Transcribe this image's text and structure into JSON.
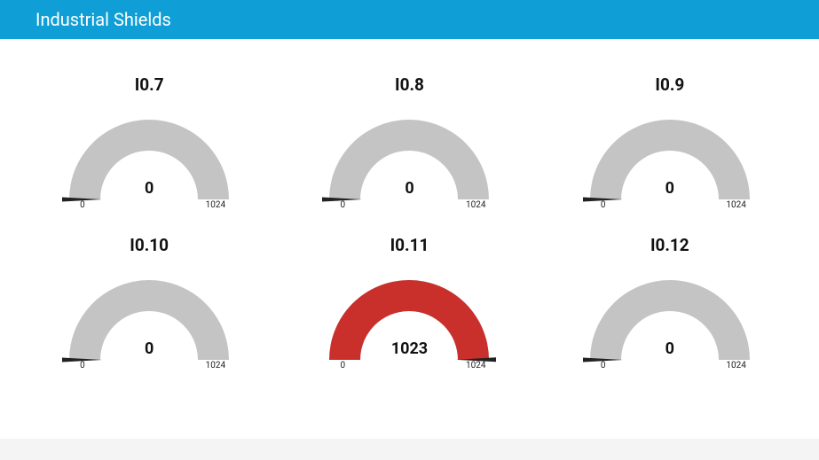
{
  "header": {
    "title": "Industrial Shields"
  },
  "colors": {
    "track": "#c4c4c4",
    "needle": "#222222",
    "fill_normal": "#c4c4c4",
    "fill_alert": "#c9302c"
  },
  "gauge_defaults": {
    "min": 0,
    "max": 1024,
    "min_label": "0",
    "max_label": "1024"
  },
  "gauges": [
    {
      "id": "i0-7",
      "title": "I0.7",
      "value": 0,
      "fill_color": "#c4c4c4"
    },
    {
      "id": "i0-8",
      "title": "I0.8",
      "value": 0,
      "fill_color": "#c4c4c4"
    },
    {
      "id": "i0-9",
      "title": "I0.9",
      "value": 0,
      "fill_color": "#c4c4c4"
    },
    {
      "id": "i0-10",
      "title": "I0.10",
      "value": 0,
      "fill_color": "#c4c4c4"
    },
    {
      "id": "i0-11",
      "title": "I0.11",
      "value": 1023,
      "fill_color": "#c9302c"
    },
    {
      "id": "i0-12",
      "title": "I0.12",
      "value": 0,
      "fill_color": "#c4c4c4"
    }
  ],
  "chart_data": [
    {
      "type": "gauge",
      "title": "I0.7",
      "value": 0,
      "min": 0,
      "max": 1024
    },
    {
      "type": "gauge",
      "title": "I0.8",
      "value": 0,
      "min": 0,
      "max": 1024
    },
    {
      "type": "gauge",
      "title": "I0.9",
      "value": 0,
      "min": 0,
      "max": 1024
    },
    {
      "type": "gauge",
      "title": "I0.10",
      "value": 0,
      "min": 0,
      "max": 1024
    },
    {
      "type": "gauge",
      "title": "I0.11",
      "value": 1023,
      "min": 0,
      "max": 1024
    },
    {
      "type": "gauge",
      "title": "I0.12",
      "value": 0,
      "min": 0,
      "max": 1024
    }
  ]
}
